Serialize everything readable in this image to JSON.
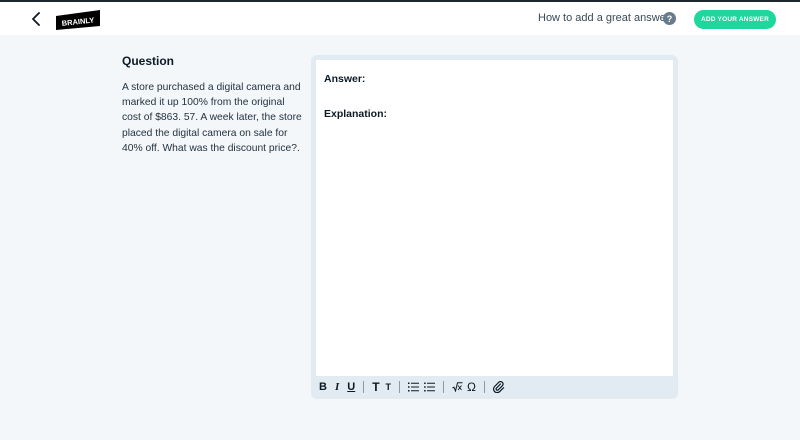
{
  "header": {
    "logo_text": "BRAINLY",
    "help_link": "How to add a great answer",
    "help_icon_glyph": "?",
    "add_answer_label": "ADD YOUR ANSWER"
  },
  "question": {
    "title": "Question",
    "body": "A store purchased a digital camera and marked it up 100% from the original cost of $863. 57. A week later, the store placed the digital camera on sale for 40% off. What was the discount price?."
  },
  "editor": {
    "answer_label": "Answer:",
    "explanation_label": "Explanation:",
    "toolbar": {
      "bold": "B",
      "italic": "I",
      "underline": "U",
      "heading_large": "T",
      "heading_small": "T",
      "omega": "Ω"
    },
    "icons": [
      "bold-icon",
      "italic-icon",
      "underline-icon",
      "text-large-icon",
      "text-small-icon",
      "ordered-list-icon",
      "bullet-list-icon",
      "square-root-icon",
      "omega-icon",
      "paperclip-icon"
    ]
  },
  "colors": {
    "accent": "#1ed79c",
    "background": "#f3f7fa",
    "editor_frame": "#e2ebf2"
  }
}
